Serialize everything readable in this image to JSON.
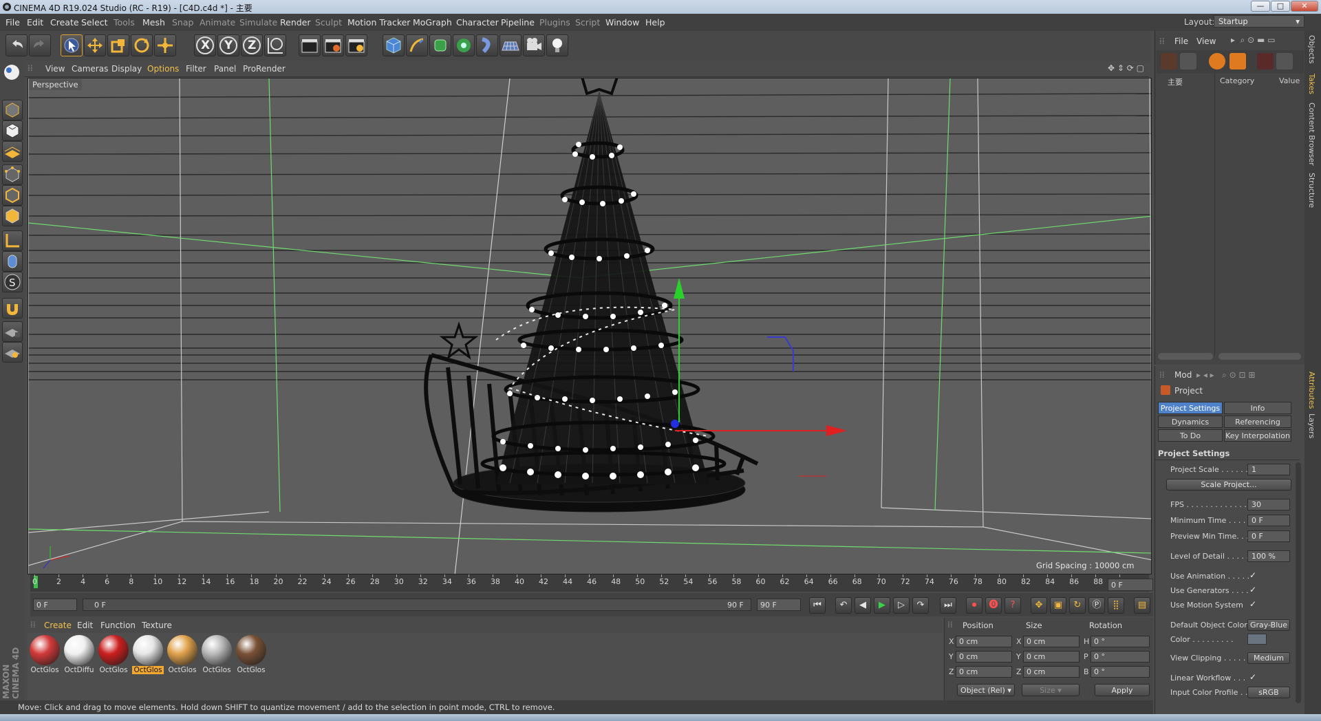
{
  "window": {
    "title": "CINEMA 4D R19.024 Studio (RC - R19) - [C4D.c4d *] - 主要",
    "btn_min": "—",
    "btn_max": "□",
    "btn_close": "✕"
  },
  "menubar": {
    "items": [
      "File",
      "Edit",
      "Create",
      "Select",
      "Tools",
      "Mesh",
      "Snap",
      "Animate",
      "Simulate",
      "Render",
      "Sculpt",
      "Motion Tracker",
      "MoGraph",
      "Character",
      "Pipeline",
      "Plugins",
      "Script",
      "Window",
      "Help"
    ],
    "layout_label": "Layout:",
    "layout_value": "Startup"
  },
  "toolbar": {
    "axis_x": "X",
    "axis_y": "Y",
    "axis_z": "Z"
  },
  "viewport": {
    "menu": [
      "View",
      "Cameras",
      "Display",
      "Options",
      "Filter",
      "Panel",
      "ProRender"
    ],
    "active_menu": "Options",
    "camera_label": "Perspective",
    "grid_spacing": "Grid Spacing : 10000 cm"
  },
  "timeline": {
    "ticks": [
      "0",
      "2",
      "4",
      "6",
      "8",
      "10",
      "12",
      "14",
      "16",
      "18",
      "20",
      "22",
      "24",
      "26",
      "28",
      "30",
      "32",
      "34",
      "36",
      "38",
      "40",
      "42",
      "44",
      "46",
      "48",
      "50",
      "52",
      "54",
      "56",
      "58",
      "60",
      "62",
      "64",
      "66",
      "68",
      "70",
      "72",
      "74",
      "76",
      "78",
      "80",
      "82",
      "84",
      "86",
      "88",
      "90"
    ],
    "current_frame": "0 F",
    "start_frame": "0 F",
    "range_start": "0 F",
    "range_end": "90 F",
    "end_frame": "90 F"
  },
  "materials": {
    "menu": [
      "Create",
      "Edit",
      "Function",
      "Texture"
    ],
    "items": [
      {
        "label": "OctGlos",
        "color": "#d23a3a",
        "selected": false
      },
      {
        "label": "OctDiffu",
        "color": "#f0f0f0",
        "selected": false
      },
      {
        "label": "OctGlos",
        "color": "#cc1f1f",
        "selected": false
      },
      {
        "label": "OctGlos",
        "color": "#e6e6e6",
        "selected": true
      },
      {
        "label": "OctGlos",
        "color": "#e0a24c",
        "selected": false
      },
      {
        "label": "OctGlos",
        "color": "#b9b9b9",
        "selected": false
      },
      {
        "label": "OctGlos",
        "color": "#7a5236",
        "selected": false
      }
    ],
    "brand": "MAXON CINEMA 4D"
  },
  "coordinates": {
    "headers": [
      "Position",
      "Size",
      "Rotation"
    ],
    "rows": [
      {
        "pos_axis": "X",
        "pos": "0 cm",
        "size_axis": "X",
        "size": "0 cm",
        "rot_axis": "H",
        "rot": "0 °"
      },
      {
        "pos_axis": "Y",
        "pos": "0 cm",
        "size_axis": "Y",
        "size": "0 cm",
        "rot_axis": "P",
        "rot": "0 °"
      },
      {
        "pos_axis": "Z",
        "pos": "0 cm",
        "size_axis": "Z",
        "size": "0 cm",
        "rot_axis": "B",
        "rot": "0 °"
      }
    ],
    "mode": "Object (Rel)",
    "size_mode": "Size",
    "apply": "Apply"
  },
  "status": {
    "text": "Move: Click and drag to move elements. Hold down SHIFT to quantize movement / add to the selection in point mode, CTRL to remove."
  },
  "objects_panel": {
    "menu": [
      "File",
      "View"
    ],
    "columns": [
      "主要",
      "Category",
      "Value"
    ]
  },
  "attributes": {
    "mode": "Mod",
    "object": "Project",
    "tabs": [
      [
        "Project Settings",
        "Info"
      ],
      [
        "Dynamics",
        "Referencing"
      ],
      [
        "To Do",
        "Key Interpolation"
      ]
    ],
    "active_tab": "Project Settings",
    "section": "Project Settings",
    "project_scale_label": "Project Scale . . . . . .",
    "project_scale": "1",
    "scale_project_btn": "Scale Project...",
    "fps_label": "FPS . . . . . . . . . . . . . .",
    "fps": "30",
    "min_time_label": "Minimum Time . . . . .",
    "min_time": "0 F",
    "preview_min_label": "Preview Min Time. . .",
    "preview_min": "0 F",
    "lod_label": "Level of Detail . . . . .",
    "lod": "100 %",
    "use_animation": "Use Animation . . . . .",
    "use_generators": "Use Generators . . . .",
    "use_motion": "Use Motion System",
    "checkmark": "✓",
    "default_color_label": "Default Object Color",
    "default_color": "Gray-Blue",
    "color_label": "Color . . . . . . . . .",
    "view_clipping_label": "View Clipping . . . . .",
    "view_clipping": "Medium",
    "linear_workflow": "Linear Workflow . . .",
    "input_profile_label": "Input Color Profile . .",
    "input_profile": "sRGB"
  },
  "side_tabs": [
    "Objects",
    "Takes",
    "Content Browser",
    "Structure",
    "Attributes",
    "Layers"
  ]
}
